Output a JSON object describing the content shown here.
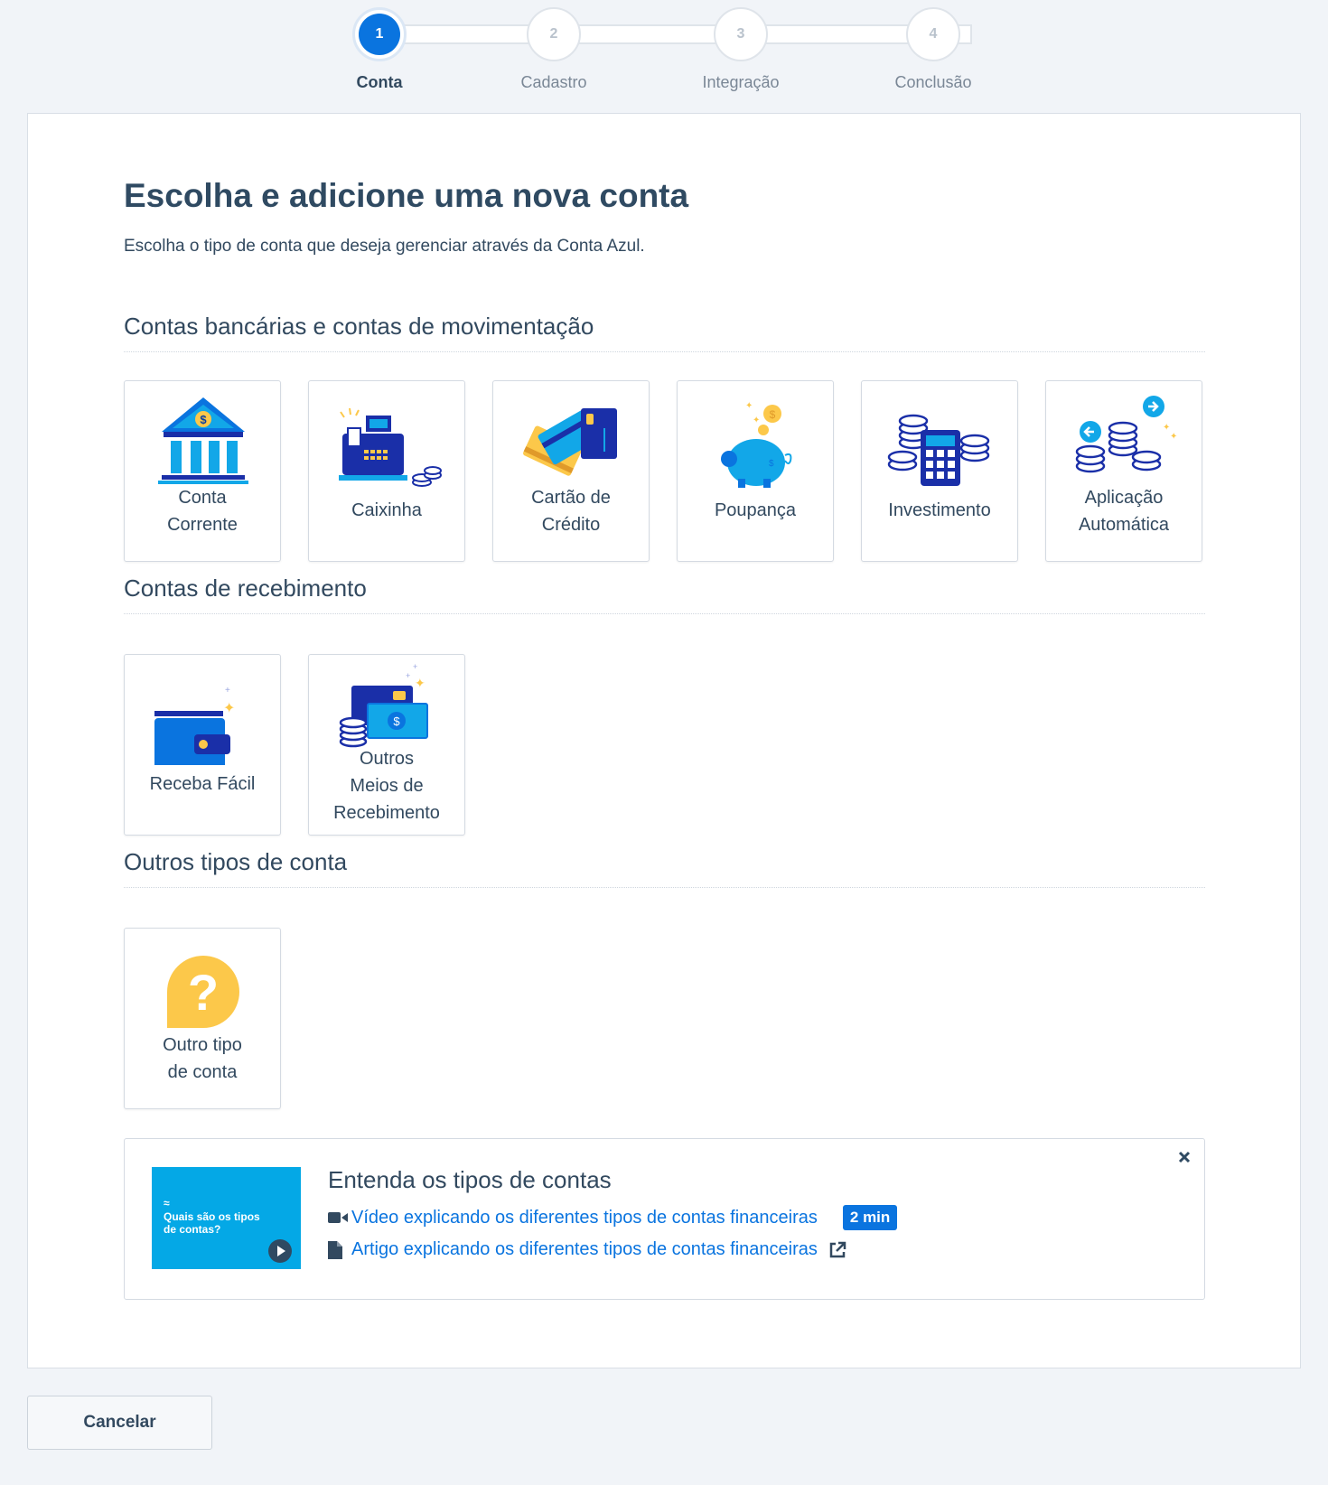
{
  "colors": {
    "primary": "#0a74df",
    "text": "#32495f",
    "background": "#f1f4f8",
    "thumb": "#04a8e6",
    "accent_yellow": "#fcc84a"
  },
  "stepper": {
    "current": 1,
    "steps": [
      {
        "number": "1",
        "label": "Conta"
      },
      {
        "number": "2",
        "label": "Cadastro"
      },
      {
        "number": "3",
        "label": "Integração"
      },
      {
        "number": "4",
        "label": "Conclusão"
      }
    ]
  },
  "main": {
    "title": "Escolha e adicione uma nova conta",
    "subtitle": "Escolha o tipo de conta que deseja gerenciar através da Conta Azul.",
    "sections": [
      {
        "title": "Contas bancárias e contas de movimentação",
        "cards": [
          {
            "icon": "bank-icon",
            "lines": [
              "Conta",
              "Corrente"
            ]
          },
          {
            "icon": "cash-register-icon",
            "lines": [
              "Caixinha"
            ]
          },
          {
            "icon": "credit-cards-icon",
            "lines": [
              "Cartão de",
              "Crédito"
            ]
          },
          {
            "icon": "piggy-bank-icon",
            "lines": [
              "Poupança"
            ]
          },
          {
            "icon": "calculator-coins-icon",
            "lines": [
              "Investimento"
            ]
          },
          {
            "icon": "coins-arrows-icon",
            "lines": [
              "Aplicação",
              "Automática"
            ]
          }
        ]
      },
      {
        "title": "Contas de recebimento",
        "cards": [
          {
            "icon": "wallet-icon",
            "lines": [
              "Receba Fácil"
            ]
          },
          {
            "icon": "money-card-icon",
            "lines": [
              "Outros",
              "Meios de",
              "Recebimento"
            ]
          }
        ]
      },
      {
        "title": "Outros tipos de conta",
        "cards": [
          {
            "icon": "question-icon",
            "lines": [
              "Outro tipo",
              "de conta"
            ]
          }
        ]
      }
    ]
  },
  "help": {
    "thumbnail_text": "Quais são os tipos de contas?",
    "title": "Entenda os tipos de contas",
    "video_link": "Vídeo explicando os diferentes tipos de contas financeiras",
    "video_duration": "2 min",
    "article_link": "Artigo explicando os diferentes tipos de contas financeiras"
  },
  "footer": {
    "cancel_label": "Cancelar"
  }
}
